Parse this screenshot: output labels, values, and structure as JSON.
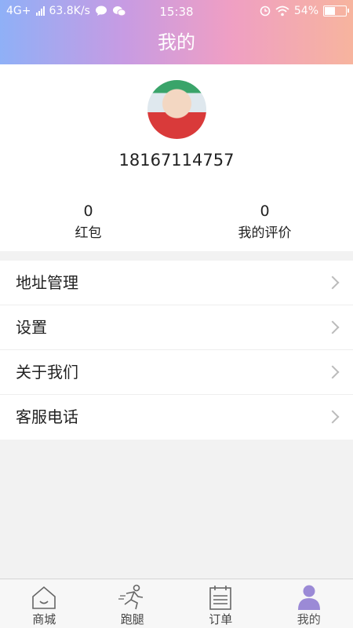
{
  "status_bar": {
    "network": "4G+",
    "speed": "63.8K/s",
    "time": "15:38",
    "battery": "54%",
    "battery_level": 0.54
  },
  "header": {
    "title": "我的"
  },
  "profile": {
    "phone": "18167114757",
    "stats": [
      {
        "value": "0",
        "label": "红包"
      },
      {
        "value": "0",
        "label": "我的评价"
      }
    ]
  },
  "menu": [
    {
      "label": "地址管理"
    },
    {
      "label": "设置"
    },
    {
      "label": "关于我们"
    },
    {
      "label": "客服电话"
    }
  ],
  "tabbar": {
    "tabs": [
      {
        "label": "商城",
        "icon": "shop-house-icon"
      },
      {
        "label": "跑腿",
        "icon": "runner-icon"
      },
      {
        "label": "订单",
        "icon": "order-calendar-icon"
      },
      {
        "label": "我的",
        "icon": "profile-person-icon"
      }
    ],
    "active_index": 3,
    "active_color": "#9b8ad6"
  },
  "colors": {
    "header_gradient": [
      "#8fb0f7",
      "#c79be3",
      "#ef9fc4",
      "#f7b49e"
    ],
    "background": "#f2f2f2"
  }
}
